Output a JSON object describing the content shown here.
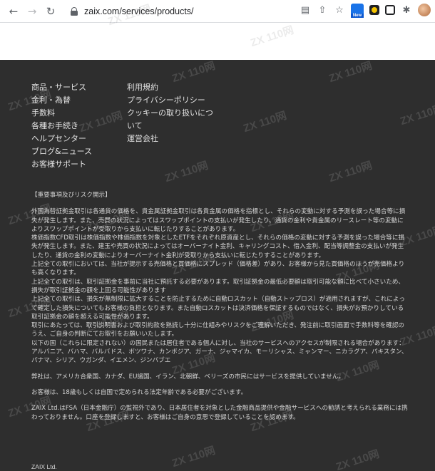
{
  "browser": {
    "url": "zaix.com/services/products/",
    "new_badge": "New"
  },
  "footer": {
    "links_left": [
      "商品・サービス",
      "金利・為替",
      "手数料",
      "各種お手続き",
      "ヘルプセンター",
      "ブログ&ニュース",
      "お客様サポート"
    ],
    "links_right": [
      "利用規約",
      "プライバシーポリシー",
      "クッキーの取り扱いについて",
      "運営会社"
    ]
  },
  "risk": {
    "heading": "【重要事項及びリスク開示】",
    "paragraphs": [
      "外国為替証拠金取引は各通貨の価格を、貴金属証拠金取引は各貴金属の価格を指標とし、それらの変動に対する予測を誤った場合等に損失が発生します。また、売買の状況によってはスワップポイントの支払いが発生したり、通貨の金利や貴金属のリースレート等の変動によりスワップポイントが受取りから支払いに転じたりすることがあります。",
      "株価指数CFD取引は株価指数や株価指数を対象としたETFをそれぞれ原資産とし、それらの価格の変動に対する予測を誤った場合等に損失が発生します。また、建玉や売買の状況によってはオーバーナイト金利、キャリングコスト、借入金利、配当等調整金の支払いが発生したり、通貨の金利の変動によりオーバーナイト金利が受取りから支払いに転じたりすることがあります。",
      "上記全ての取引においては、当社が提示する売価格と買価格にスプレッド（価格差）があり、お客様から見た買価格のほうが売価格よりも高くなります。",
      "上記全ての取引は、取引証拠金を事前に当社に預託する必要があります。取引証拠金の最低必要額は取引可能な額に比べて小さいため、損失が取引証拠金の額を上回る可能性があります",
      "上記全ての取引は、損失が無制限に拡大することを防止するために自動ロスカット（自動ストップロス）が適用されますが、これによって確定した損失についてもお客様の負担となります。また自動ロスカットは決済価格を保証するものではなく、損失がお預かりしている取引証拠金の額を超える可能性があります。",
      "取引にあたっては、取引説明書および取引約款を熟読し十分に仕組みやリスクをご理解いただき、発注前に取引画面で手数料等を確認のうえ、ご自身の判断にてお取引をお願いいたします。",
      "以下の国（これらに限定されない）の国民または居住者である個人に対し、当社のサービスへのアクセスが制限される場合があります：",
      "アルバニア、バハマ、バルバドス、ボツワナ、カンボジア、ガーナ、ジャマイカ、モーリシャス、ミャンマー、ニカラグア、パキスタン、パナマ、シリア、ウガンダ、イエメン、ジンバブエ"
    ],
    "notice_1": "弊社は、アメリカ合衆国、カナダ、EU諸国、イラン、北朝鮮、ベリーズの市民にはサービスを提供していません。",
    "notice_2": "お客様は、18歳もしくは自国で定められる法定年齢である必要がございます。",
    "notice_3": "ZAIX Ltd.はFSA（日本金融庁）の監視外であり、日本居住者を対象とした金融商品提供や金融サービスへの勧誘と考えられる業務には携わっておりません。口座を登録しますと、お客様はご自身の意思で登録していることを認めます。",
    "company": "ZAIX Ltd."
  },
  "watermark": "ZX 110网"
}
